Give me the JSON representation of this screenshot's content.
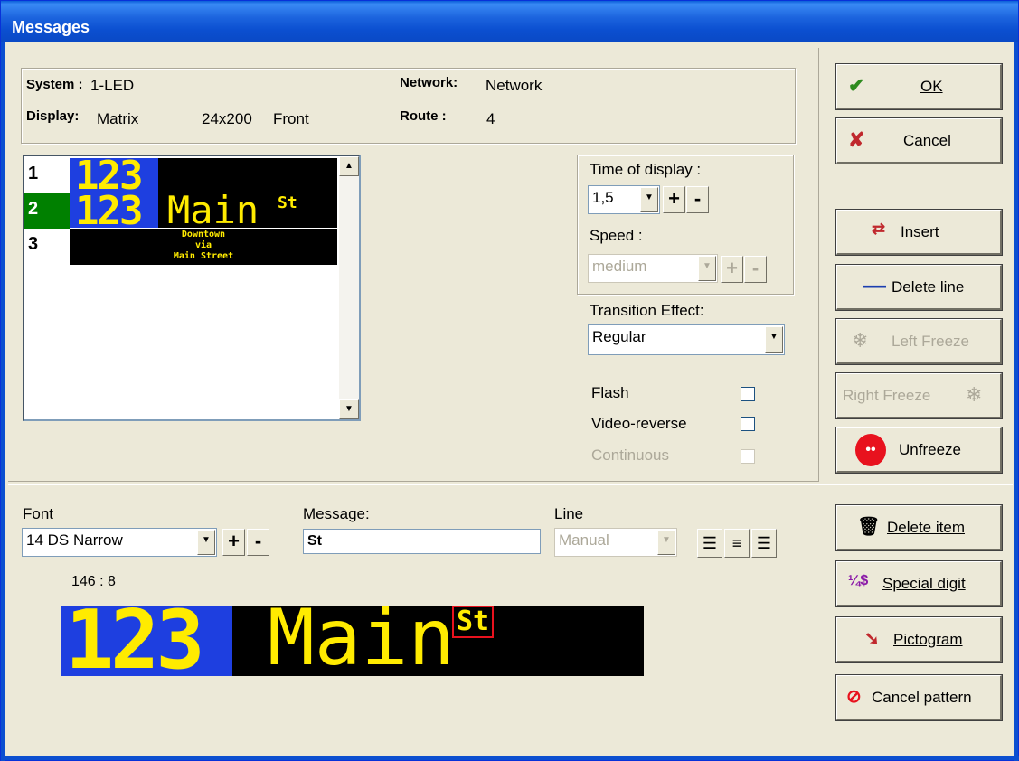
{
  "window": {
    "title": "Messages"
  },
  "info": {
    "system_label": "System :",
    "system_value": "1-LED",
    "display_label": "Display:",
    "display_value": "Matrix",
    "display_size": "24x200",
    "display_side": "Front",
    "network_label": "Network:",
    "network_value": "Network",
    "route_label": "Route :",
    "route_value": "4"
  },
  "message_list": {
    "rows": [
      {
        "number": "1",
        "route_number": "123",
        "text": "",
        "superscript": ""
      },
      {
        "number": "2",
        "route_number": "123",
        "text": "Main",
        "superscript": "St"
      },
      {
        "number": "3",
        "lines": [
          "Downtown",
          "via",
          "Main Street"
        ]
      }
    ]
  },
  "display_settings": {
    "time_label": "Time of display :",
    "time_value": "1,5",
    "speed_label": "Speed :",
    "speed_value": "medium",
    "transition_label": "Transition Effect:",
    "transition_value": "Regular",
    "flash_label": "Flash",
    "video_reverse_label": "Video-reverse",
    "continuous_label": "Continuous"
  },
  "buttons": {
    "ok": "OK",
    "cancel": "Cancel",
    "insert": "Insert",
    "delete_line": "Delete line",
    "left_freeze": "Left Freeze",
    "right_freeze": "Right Freeze",
    "unfreeze": "Unfreeze",
    "delete_item": "Delete item",
    "special_digit": "Special digit",
    "pictogram": "Pictogram",
    "cancel_pattern": "Cancel pattern"
  },
  "editor": {
    "font_label": "Font",
    "font_value": "14 DS Narrow",
    "message_label": "Message:",
    "message_value": "St",
    "line_label": "Line",
    "line_value": "Manual",
    "position_readout": "146 : 8"
  },
  "preview": {
    "route_number": "123",
    "text": "Main",
    "superscript": "St"
  },
  "colors": {
    "led_yellow": "#ffeb00",
    "led_blue": "#1e3fe0",
    "row_selected": "#008000",
    "title_blue": "#0b4fd0"
  }
}
